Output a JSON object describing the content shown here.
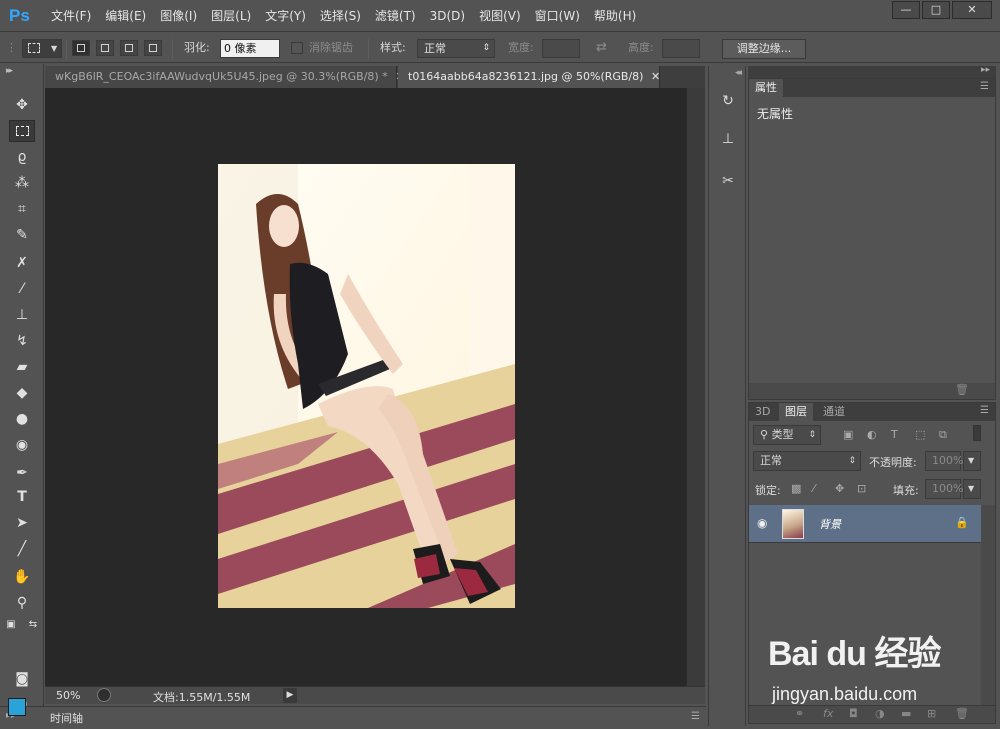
{
  "app": {
    "logo": "Ps"
  },
  "menu": [
    "文件(F)",
    "编辑(E)",
    "图像(I)",
    "图层(L)",
    "文字(Y)",
    "选择(S)",
    "滤镜(T)",
    "3D(D)",
    "视图(V)",
    "窗口(W)",
    "帮助(H)"
  ],
  "window_controls": {
    "minimize": "—",
    "maximize": "□",
    "close": "✕"
  },
  "options": {
    "feather_label": "羽化:",
    "feather_value": "0 像素",
    "antialias_label": "消除锯齿",
    "style_label": "样式:",
    "style_value": "正常",
    "width_label": "宽度:",
    "height_label": "高度:",
    "refine_edge": "调整边缘..."
  },
  "tabs": [
    {
      "label": "wKgB6lR_CEOAc3ifAAWudvqUk5U45.jpeg @ 30.3%(RGB/8) *",
      "active": false
    },
    {
      "label": "t0164aabb64a8236121.jpg @ 50%(RGB/8)",
      "active": true
    }
  ],
  "status": {
    "zoom": "50%",
    "doc_info": "文档:1.55M/1.55M"
  },
  "timeline": {
    "label": "时间轴"
  },
  "properties_panel": {
    "title": "属性",
    "empty_text": "无属性"
  },
  "layers_panel": {
    "tabs": [
      "3D",
      "图层",
      "通道"
    ],
    "active_tab": "图层",
    "filter_value": "类型",
    "blend_mode": "正常",
    "opacity_label": "不透明度:",
    "opacity_value": "100%",
    "lock_label": "锁定:",
    "fill_label": "填充:",
    "fill_value": "100%",
    "layers": [
      {
        "name": "背景",
        "visible": true,
        "locked": true
      }
    ]
  },
  "watermark": {
    "logo": "Bai du 经验",
    "url": "jingyan.baidu.com"
  },
  "colors": {
    "foreground": "#29a3d8",
    "background": "#ffffff",
    "accent": "#31a8ff"
  }
}
